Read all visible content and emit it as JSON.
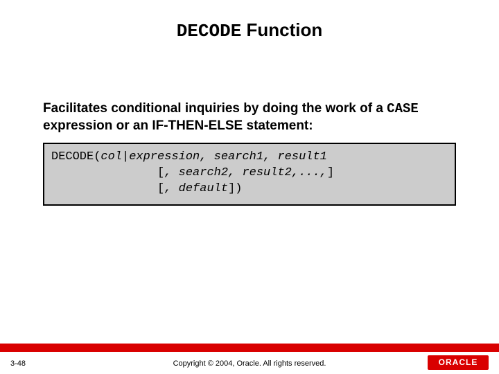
{
  "title": {
    "mono": "DECODE",
    "rest": " Function"
  },
  "body": {
    "line1": "Facilitates conditional inquiries by doing the work of a ",
    "mono": "CASE",
    "line2": " expression or an IF-THEN-ELSE statement:"
  },
  "code": {
    "t1": "DECODE(",
    "i1": "col|expression, search1, result1",
    "t2": "\n               [",
    "i2": ", search2, result2,...,",
    "t3": "]\n               [",
    "i3": ", default",
    "t4": "])"
  },
  "footer": {
    "page": "3-48",
    "copyright": "Copyright © 2004, Oracle.  All rights reserved.",
    "logo": "ORACLE"
  }
}
